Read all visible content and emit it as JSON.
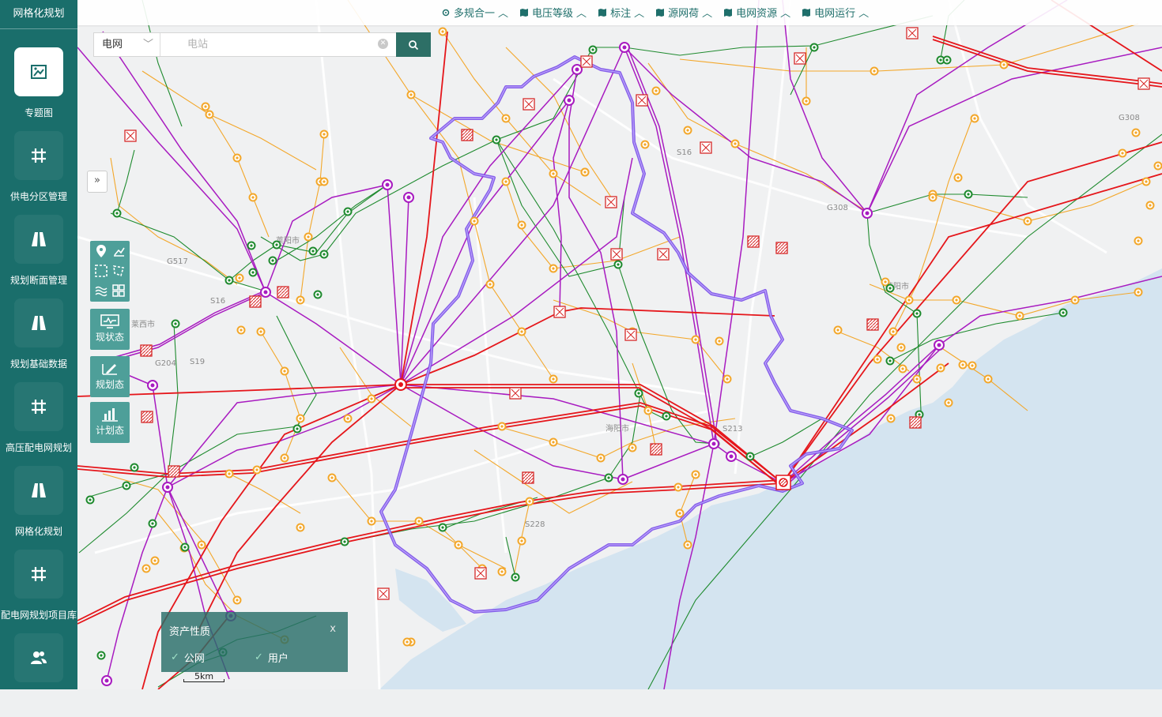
{
  "app": {
    "title": "网格化规划"
  },
  "sidebar": {
    "items": [
      {
        "label": "专题图",
        "icon": "image-icon",
        "active": true
      },
      {
        "label": "供电分区管理",
        "icon": "grid-icon"
      },
      {
        "label": "规划断面管理",
        "icon": "road-icon"
      },
      {
        "label": "规划基础数据",
        "icon": "road-icon"
      },
      {
        "label": "高压配电网规划",
        "icon": "grid-icon"
      },
      {
        "label": "网格化规划",
        "icon": "road-icon"
      },
      {
        "label": "配电网规划项目库",
        "icon": "grid-icon"
      },
      {
        "label": "",
        "icon": "users-icon"
      }
    ]
  },
  "topbar": {
    "items": [
      {
        "label": "多规合一",
        "icon": "gear-icon"
      },
      {
        "label": "电压等级",
        "icon": "map-icon"
      },
      {
        "label": "标注",
        "icon": "map-icon"
      },
      {
        "label": "源网荷",
        "icon": "map-icon"
      },
      {
        "label": "电网资源",
        "icon": "map-icon"
      },
      {
        "label": "电网运行",
        "icon": "map-icon"
      }
    ]
  },
  "search": {
    "type_value": "电网",
    "placeholder": "电站"
  },
  "states": [
    {
      "label": "现状态"
    },
    {
      "label": "规划态"
    },
    {
      "label": "计划态"
    }
  ],
  "legend": {
    "title": "资产性质",
    "close": "x",
    "options": [
      {
        "label": "公网",
        "checked": true
      },
      {
        "label": "用户",
        "checked": true
      }
    ]
  },
  "scale": {
    "label": "5km"
  },
  "map_labels": [
    "G308",
    "G308",
    "S16",
    "S16",
    "G517",
    "G204",
    "S19",
    "S228",
    "莱西市",
    "莱阳市",
    "海阳市",
    "S213",
    "莱阳市"
  ],
  "colors": {
    "sidebar": "#1a6e6b",
    "accent": "#2d6f66",
    "line_500kv": "#e5161b",
    "line_220kv": "#a81bc0",
    "line_110kv": "#1e8a2e",
    "line_35kv": "#f3a72a",
    "boundary": "#7a4fe8",
    "sea": "#d4e4f0"
  }
}
